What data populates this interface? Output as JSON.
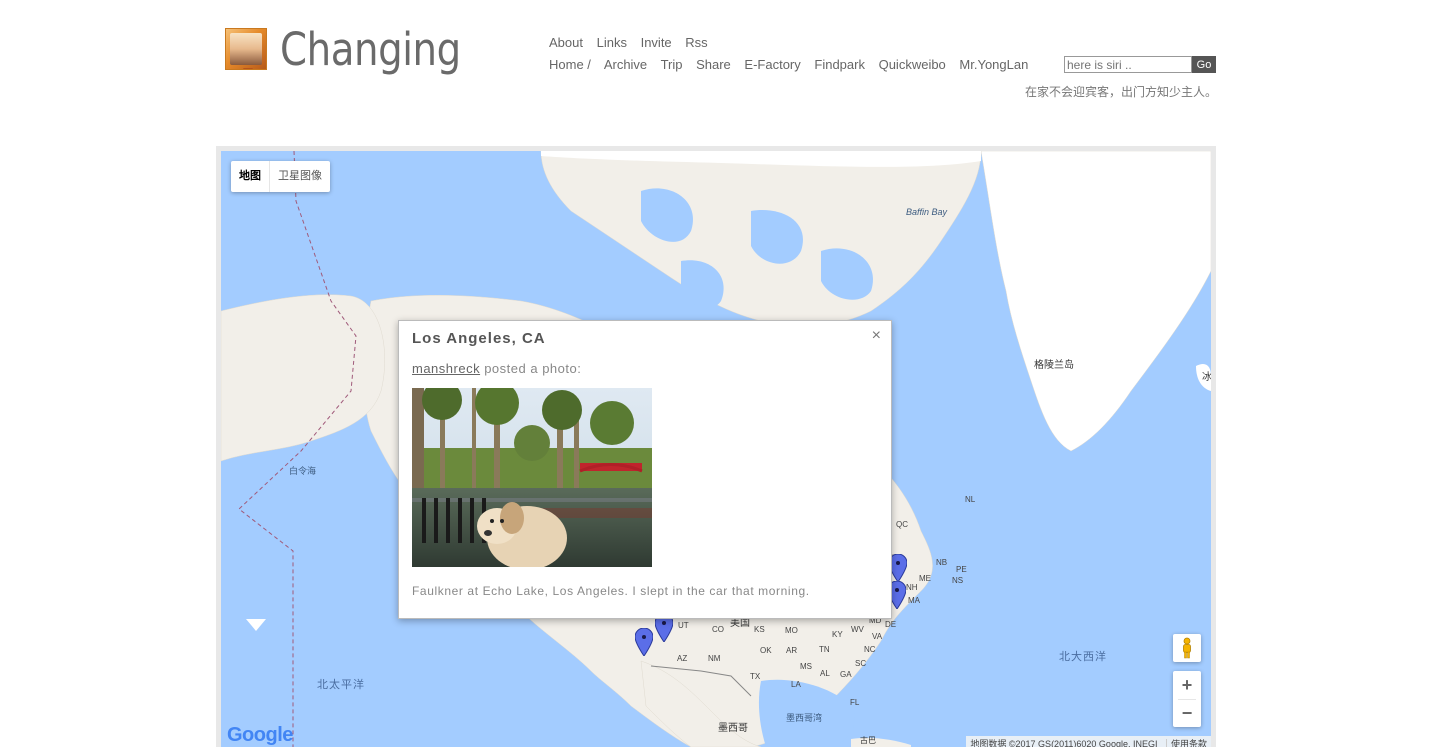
{
  "header": {
    "site_title": "Changing",
    "nav_top": [
      "About",
      "Links",
      "Invite",
      "Rss"
    ],
    "nav_main": [
      "Home /",
      "Archive",
      "Trip",
      "Share",
      "E-Factory",
      "Findpark",
      "Quickweibo",
      "Mr.YongLan"
    ],
    "search_placeholder": "here is siri ..",
    "search_button": "Go",
    "motto": "在家不会迎宾客，出门方知少主人。"
  },
  "map": {
    "type_controls": [
      "地图",
      "卫星图像"
    ],
    "active_type": "地图",
    "labels": {
      "baffin_bay": "Baffin Bay",
      "greenland": "格陵兰岛",
      "iceland_partial": "冰",
      "bering_sea": "白令海",
      "north_pacific": "北太平洋",
      "north_atlantic": "北大西洋",
      "mexico": "墨西哥",
      "gulf_of_mexico": "墨西哥湾",
      "usa": "美国",
      "cuba": "古巴",
      "states": [
        "QC",
        "NB",
        "PE",
        "NS",
        "NL",
        "ME",
        "NH",
        "MA",
        "DE",
        "MD",
        "VA",
        "KY",
        "WV",
        "TN",
        "NC",
        "SC",
        "GA",
        "AL",
        "MS",
        "LA",
        "FL",
        "AR",
        "OK",
        "TX",
        "KS",
        "MO",
        "CO",
        "UT",
        "AZ",
        "NM"
      ]
    },
    "zoom_in": "+",
    "zoom_out": "−",
    "google_logo": "Google",
    "attribution": "地图数据 ©2017 GS(2011)6020 Google, INEGI",
    "terms": "使用条款"
  },
  "info_window": {
    "title": "Los Angeles, CA",
    "user": "manshreck",
    "posted_text": "posted a photo:",
    "caption": "Faulkner at Echo Lake, Los Angeles. I slept in the car that morning.",
    "close": "×"
  },
  "colors": {
    "water": "#a3ccff",
    "land": "#f2efe9",
    "ice": "#ffffff",
    "marker": "#5b6ee8"
  }
}
